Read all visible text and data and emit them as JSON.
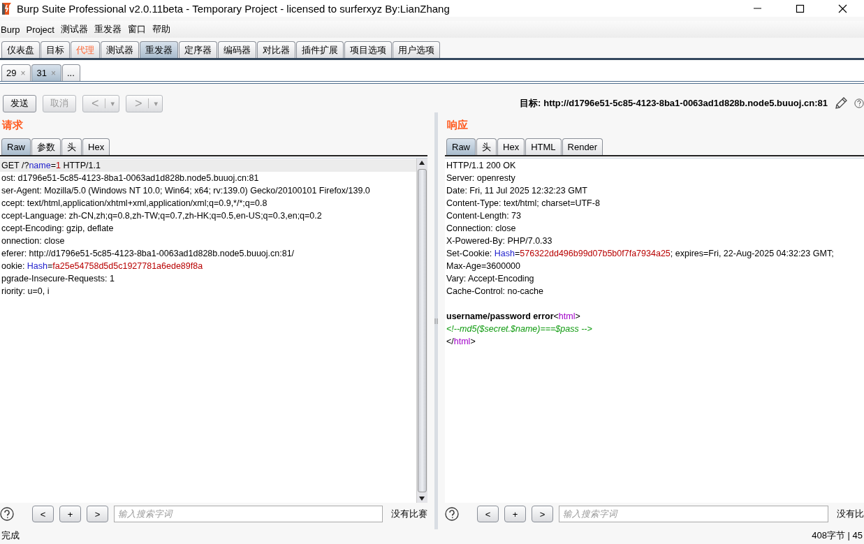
{
  "window": {
    "title": "Burp Suite Professional v2.0.11beta - Temporary Project - licensed to surferxyz By:LianZhang"
  },
  "menu": [
    "Burp",
    "Project",
    "测试器",
    "重发器",
    "窗口",
    "帮助"
  ],
  "main_tabs": [
    {
      "label": "仪表盘",
      "selected": false,
      "alert": false
    },
    {
      "label": "目标",
      "selected": false,
      "alert": false
    },
    {
      "label": "代理",
      "selected": false,
      "alert": true
    },
    {
      "label": "测试器",
      "selected": false,
      "alert": false
    },
    {
      "label": "重发器",
      "selected": true,
      "alert": false
    },
    {
      "label": "定序器",
      "selected": false,
      "alert": false
    },
    {
      "label": "编码器",
      "selected": false,
      "alert": false
    },
    {
      "label": "对比器",
      "selected": false,
      "alert": false
    },
    {
      "label": "插件扩展",
      "selected": false,
      "alert": false
    },
    {
      "label": "项目选项",
      "selected": false,
      "alert": false
    },
    {
      "label": "用户选项",
      "selected": false,
      "alert": false
    }
  ],
  "request_tabs": [
    {
      "label": "29",
      "close": "×",
      "selected": false
    },
    {
      "label": "31",
      "close": "×",
      "selected": true
    },
    {
      "label": "...",
      "selected": false
    }
  ],
  "toolbar": {
    "buttons": [
      {
        "label": "发送",
        "disabled": false
      },
      {
        "label": "取消",
        "disabled": true
      }
    ],
    "nav": [
      {
        "label": "<",
        "menu": "▾",
        "disabled": true
      },
      {
        "label": ">",
        "menu": "▾",
        "disabled": true
      }
    ],
    "target_label": "目标:",
    "target_url": "http://d1796e51-5c85-4123-8ba1-0063ad1d828b.node5.buuoj.cn:81"
  },
  "request": {
    "title": "请求",
    "scrollbar": true,
    "tabs": [
      {
        "label": "Raw",
        "selected": true
      },
      {
        "label": "参数",
        "selected": false
      },
      {
        "label": "头",
        "selected": false
      },
      {
        "label": "Hex",
        "selected": false
      }
    ],
    "lines": [
      {
        "current": true,
        "parts": [
          {
            "kind": "plain",
            "text": "GET /?"
          },
          {
            "kind": "key",
            "text": "name"
          },
          {
            "kind": "plain",
            "text": "="
          },
          {
            "kind": "value",
            "text": "1"
          },
          {
            "kind": "plain",
            "text": " HTTP/1.1"
          }
        ]
      },
      {
        "parts": [
          {
            "kind": "plain",
            "text": "ost: d1796e51-5c85-4123-8ba1-0063ad1d828b.node5.buuoj.cn:81"
          }
        ]
      },
      {
        "parts": [
          {
            "kind": "plain",
            "text": "ser-Agent: Mozilla/5.0 (Windows NT 10.0; Win64; x64; rv:139.0) Gecko/20100101 Firefox/139.0"
          }
        ]
      },
      {
        "parts": [
          {
            "kind": "plain",
            "text": "ccept: text/html,application/xhtml+xml,application/xml;q=0.9,*/*;q=0.8"
          }
        ]
      },
      {
        "parts": [
          {
            "kind": "plain",
            "text": "ccept-Language: zh-CN,zh;q=0.8,zh-TW;q=0.7,zh-HK;q=0.5,en-US;q=0.3,en;q=0.2"
          }
        ]
      },
      {
        "parts": [
          {
            "kind": "plain",
            "text": "ccept-Encoding: gzip, deflate"
          }
        ]
      },
      {
        "parts": [
          {
            "kind": "plain",
            "text": "onnection: close"
          }
        ]
      },
      {
        "parts": [
          {
            "kind": "plain",
            "text": "eferer: http://d1796e51-5c85-4123-8ba1-0063ad1d828b.node5.buuoj.cn:81/"
          }
        ]
      },
      {
        "parts": [
          {
            "kind": "plain",
            "text": "ookie: "
          },
          {
            "kind": "key",
            "text": "Hash"
          },
          {
            "kind": "plain",
            "text": "="
          },
          {
            "kind": "value",
            "text": "fa25e54758d5d5c1927781a6ede89f8a"
          }
        ]
      },
      {
        "parts": [
          {
            "kind": "plain",
            "text": "pgrade-Insecure-Requests: 1"
          }
        ]
      },
      {
        "parts": [
          {
            "kind": "plain",
            "text": "riority: u=0, i"
          }
        ]
      }
    ],
    "search": {
      "prev": "<",
      "add": "+",
      "next": ">",
      "placeholder": "输入搜索字词",
      "result": "没有比赛"
    }
  },
  "response": {
    "title": "响应",
    "tabs": [
      {
        "label": "Raw",
        "selected": true
      },
      {
        "label": "头",
        "selected": false
      },
      {
        "label": "Hex",
        "selected": false
      },
      {
        "label": "HTML",
        "selected": false
      },
      {
        "label": "Render",
        "selected": false
      }
    ],
    "lines": [
      {
        "parts": [
          {
            "kind": "plain",
            "text": "HTTP/1.1 200 OK"
          }
        ]
      },
      {
        "parts": [
          {
            "kind": "plain",
            "text": "Server: openresty"
          }
        ]
      },
      {
        "parts": [
          {
            "kind": "plain",
            "text": "Date: Fri, 11 Jul 2025 12:32:23 GMT"
          }
        ]
      },
      {
        "parts": [
          {
            "kind": "plain",
            "text": "Content-Type: text/html; charset=UTF-8"
          }
        ]
      },
      {
        "parts": [
          {
            "kind": "plain",
            "text": "Content-Length: 73"
          }
        ]
      },
      {
        "parts": [
          {
            "kind": "plain",
            "text": "Connection: close"
          }
        ]
      },
      {
        "parts": [
          {
            "kind": "plain",
            "text": "X-Powered-By: PHP/7.0.33"
          }
        ]
      },
      {
        "parts": [
          {
            "kind": "plain",
            "text": "Set-Cookie: "
          },
          {
            "kind": "key",
            "text": "Hash"
          },
          {
            "kind": "plain",
            "text": "="
          },
          {
            "kind": "value",
            "text": "576322dd496b99d07b5b0f7fa7934a25"
          },
          {
            "kind": "plain",
            "text": "; expires=Fri, 22-Aug-2025 04:32:23 GMT;"
          }
        ]
      },
      {
        "parts": [
          {
            "kind": "plain",
            "text": "Max-Age=3600000"
          }
        ]
      },
      {
        "parts": [
          {
            "kind": "plain",
            "text": "Vary: Accept-Encoding"
          }
        ]
      },
      {
        "parts": [
          {
            "kind": "plain",
            "text": "Cache-Control: no-cache"
          }
        ]
      },
      {
        "gap_before": true,
        "parts": [
          {
            "kind": "bold",
            "text": "username/password error"
          },
          {
            "kind": "plain",
            "text": "<"
          },
          {
            "kind": "tag",
            "text": "html"
          },
          {
            "kind": "plain",
            "text": ">"
          }
        ]
      },
      {
        "parts": [
          {
            "kind": "comment",
            "text": "<!--md5($secret.$name)===$pass -->"
          }
        ]
      },
      {
        "parts": [
          {
            "kind": "plain",
            "text": "</"
          },
          {
            "kind": "tag",
            "text": "html"
          },
          {
            "kind": "plain",
            "text": ">"
          }
        ]
      }
    ],
    "search": {
      "prev": "<",
      "add": "+",
      "next": ">",
      "placeholder": "输入搜索字词",
      "result": "没有比"
    }
  },
  "status_bar": {
    "left": "完成",
    "right": "408字节 | 45"
  }
}
